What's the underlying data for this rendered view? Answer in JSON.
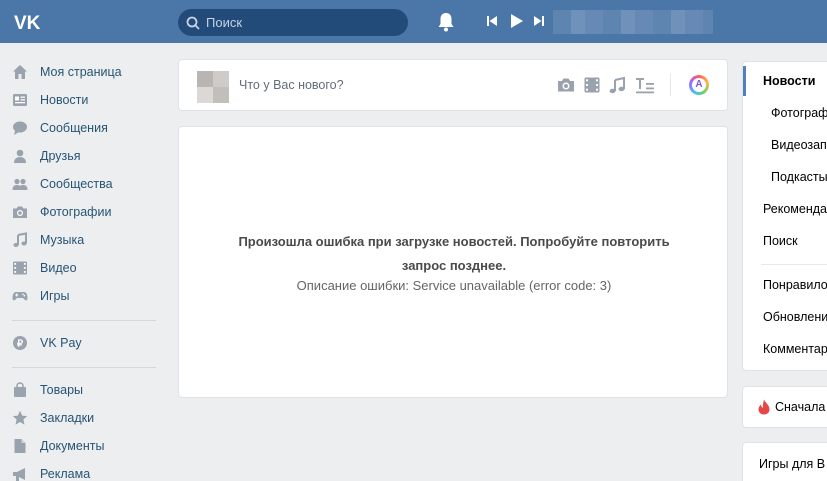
{
  "header": {
    "logo": "VK",
    "search_placeholder": "Поиск",
    "icons": [
      "vk-logo",
      "search-icon",
      "bell-icon",
      "prev-track-icon",
      "play-icon",
      "next-track-icon"
    ]
  },
  "left_nav": {
    "items": [
      {
        "label": "Моя страница",
        "icon": "home-icon"
      },
      {
        "label": "Новости",
        "icon": "news-icon"
      },
      {
        "label": "Сообщения",
        "icon": "messages-icon"
      },
      {
        "label": "Друзья",
        "icon": "friends-icon"
      },
      {
        "label": "Сообщества",
        "icon": "communities-icon"
      },
      {
        "label": "Фотографии",
        "icon": "camera-icon"
      },
      {
        "label": "Музыка",
        "icon": "music-icon"
      },
      {
        "label": "Видео",
        "icon": "video-icon"
      },
      {
        "label": "Игры",
        "icon": "gamepad-icon"
      },
      {
        "label": "VK Pay",
        "icon": "vkpay-icon"
      },
      {
        "label": "Товары",
        "icon": "bag-icon"
      },
      {
        "label": "Закладки",
        "icon": "star-icon"
      },
      {
        "label": "Документы",
        "icon": "document-icon"
      },
      {
        "label": "Реклама",
        "icon": "megaphone-icon"
      }
    ]
  },
  "post_box": {
    "placeholder": "Что у Вас нового?",
    "icons": [
      "camera-icon",
      "video-icon",
      "music-icon",
      "text-format-icon",
      "avatar-style-icon"
    ],
    "style_letter": "A"
  },
  "error": {
    "title": "Произошла ошибка при загрузке новостей. Попробуйте повторить запрос позднее.",
    "description": "Описание ошибки: Service unavailable (error code: 3)"
  },
  "right_menu": {
    "items": [
      {
        "label": "Новости",
        "active": true
      },
      {
        "label": "Фотографи"
      },
      {
        "label": "Видеозап"
      },
      {
        "label": "Подкасты"
      },
      {
        "label": "Рекоменда"
      },
      {
        "label": "Поиск"
      },
      {
        "label": "Понравило"
      },
      {
        "label": "Обновлени"
      },
      {
        "label": "Комментар"
      }
    ],
    "box1": "Сначала",
    "box2": "Игры для В"
  },
  "colors": {
    "header": "#4a76a8",
    "search": "#224b7a",
    "link": "#285473",
    "icon": "#99a2ad",
    "background": "#edeef0",
    "accent": "#5181b8"
  }
}
